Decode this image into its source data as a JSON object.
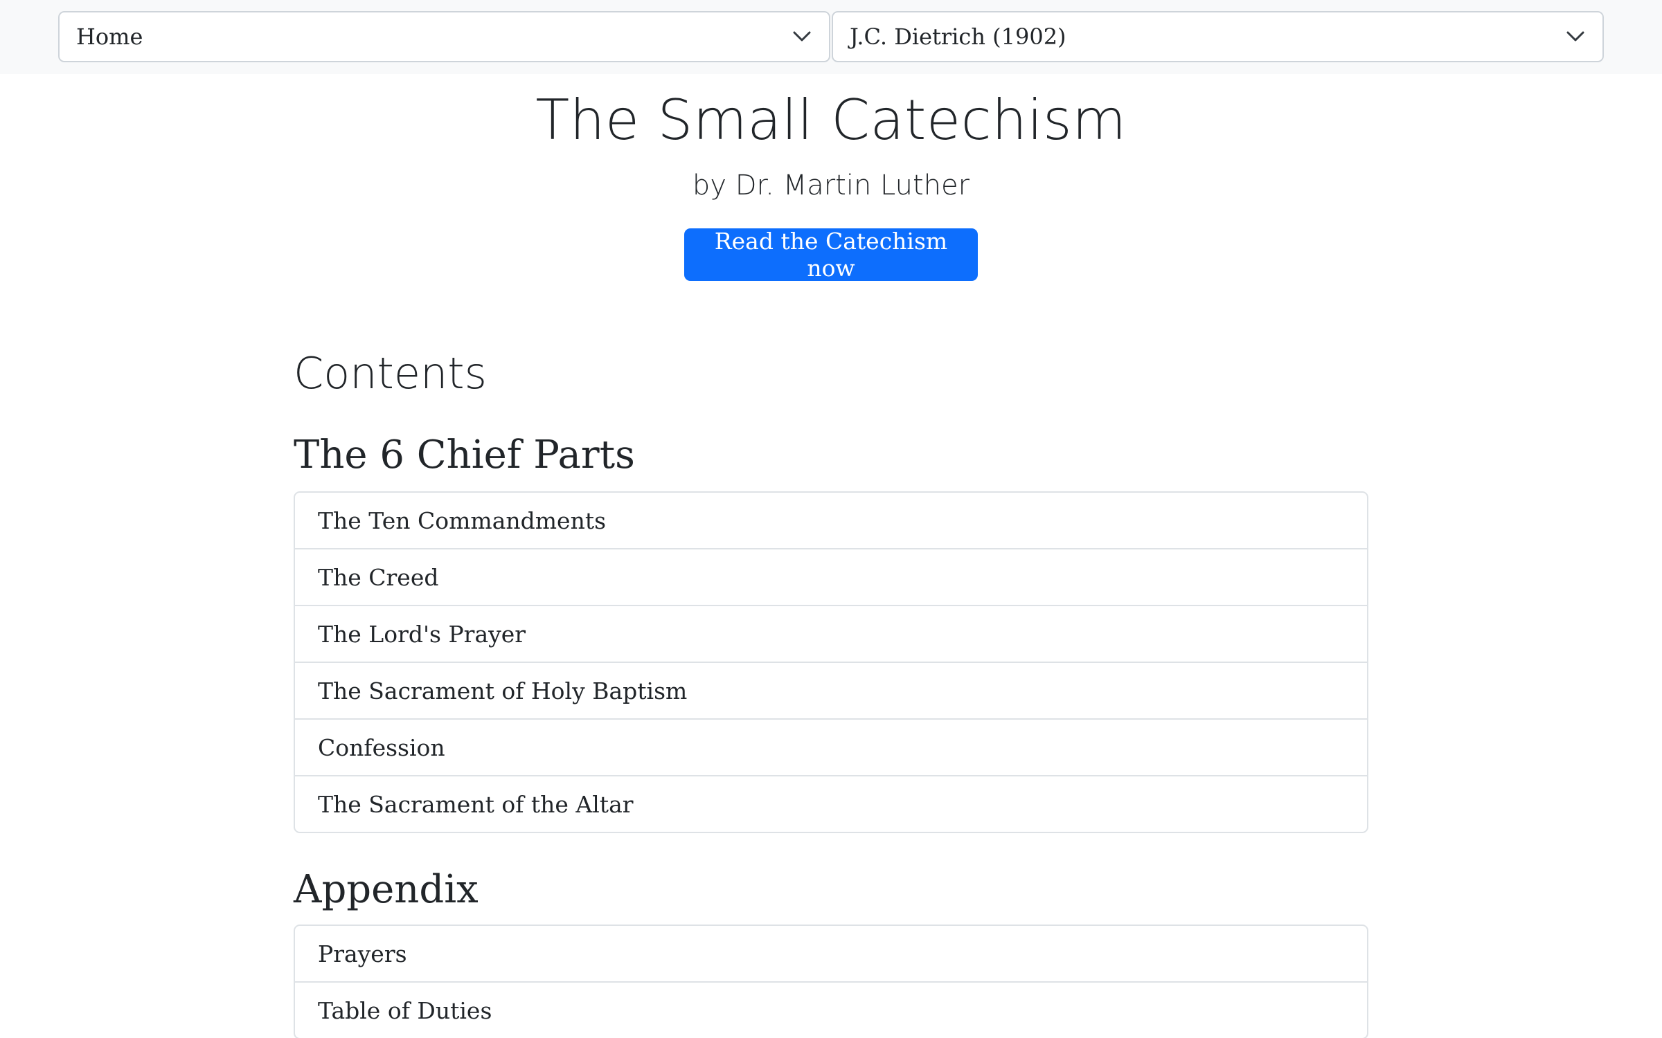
{
  "nav": {
    "page_select": {
      "selected": "Home",
      "icon": "chevron-down-icon"
    },
    "translation_select": {
      "selected": "J.C. Dietrich (1902)",
      "icon": "chevron-down-icon"
    }
  },
  "hero": {
    "title": "The Small Catechism",
    "subtitle": "by Dr. Martin Luther",
    "cta_label": "Read the Catechism now"
  },
  "contents": {
    "heading": "Contents",
    "sections": [
      {
        "heading": "The 6 Chief Parts",
        "items": [
          "The Ten Commandments",
          "The Creed",
          "The Lord's Prayer",
          "The Sacrament of Holy Baptism",
          "Confession",
          "The Sacrament of the Altar"
        ]
      },
      {
        "heading": "Appendix",
        "items": [
          "Prayers",
          "Table of Duties"
        ]
      }
    ]
  },
  "colors": {
    "primary": "#0d6efd",
    "navbar_bg": "#f8f9fa",
    "border": "#dee2e6",
    "text": "#212529"
  }
}
